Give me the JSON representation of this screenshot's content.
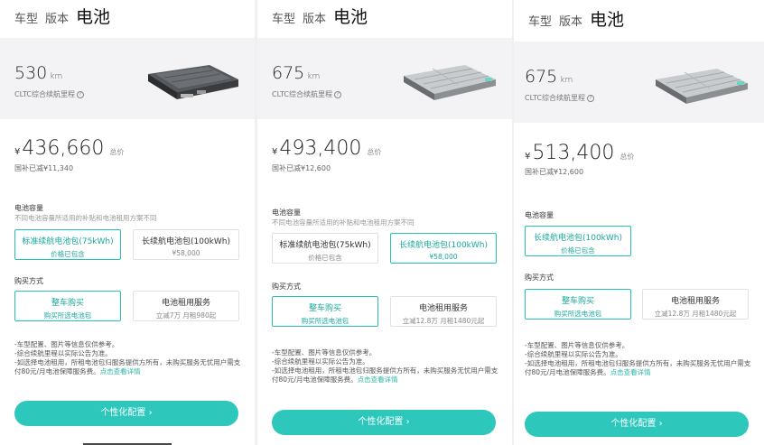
{
  "steps": [
    "车型",
    "版本",
    "电池"
  ],
  "common": {
    "range_unit": "km",
    "range_label": "CLTC综合续航里程",
    "info_icon": "?",
    "currency": "¥",
    "total_label": "总价",
    "capacity_title": "电池容量",
    "capacity_sub": "不同电池容量所适用的补贴和电池租用方案不同",
    "buy_title": "购买方式",
    "notes": [
      "-车型配置、图片等信息仅供参考。",
      "-综合续航里程以实际公告为准。",
      "-如选择电池租用，所租电池包归服务提供方所有，未购买服务无忧用户需支付80元/月电池保障服务费。"
    ],
    "notes_link": "点击查看详情",
    "cta": "个性化配置 ›"
  },
  "panels": [
    {
      "range": "530",
      "price": "436,660",
      "subsidy": "国补已减¥11,340",
      "battery_options": [
        {
          "main": "标准续航电池包(75kWh)",
          "sub": "价格已包含",
          "selected": true
        },
        {
          "main": "长续航电池包(100kWh)",
          "sub": "¥58,000",
          "selected": false
        }
      ],
      "buy_options": [
        {
          "main": "整车购买",
          "sub": "购买所选电池包",
          "selected": true
        },
        {
          "main": "电池租用服务",
          "sub": "立减7万 月租980起",
          "selected": false
        }
      ]
    },
    {
      "range": "675",
      "price": "493,400",
      "subsidy": "国补已减¥12,600",
      "battery_options": [
        {
          "main": "标准续航电池包(75kWh)",
          "sub": "价格已包含",
          "selected": false
        },
        {
          "main": "长续航电池包(100kWh)",
          "sub": "¥58,000",
          "selected": true
        }
      ],
      "buy_options": [
        {
          "main": "整车购买",
          "sub": "购买所选电池包",
          "selected": true
        },
        {
          "main": "电池租用服务",
          "sub": "立减12.8万 月租1480元起",
          "selected": false
        }
      ]
    },
    {
      "range": "675",
      "price": "513,400",
      "subsidy": "国补已减¥12,600",
      "battery_options": [
        {
          "main": "长续航电池包(100kWh)",
          "sub": "价格已包含",
          "selected": true
        }
      ],
      "buy_options": [
        {
          "main": "整车购买",
          "sub": "购买所选电池包",
          "selected": true
        },
        {
          "main": "电池租用服务",
          "sub": "立减12.8万 月租1480元起",
          "selected": false
        }
      ]
    }
  ]
}
